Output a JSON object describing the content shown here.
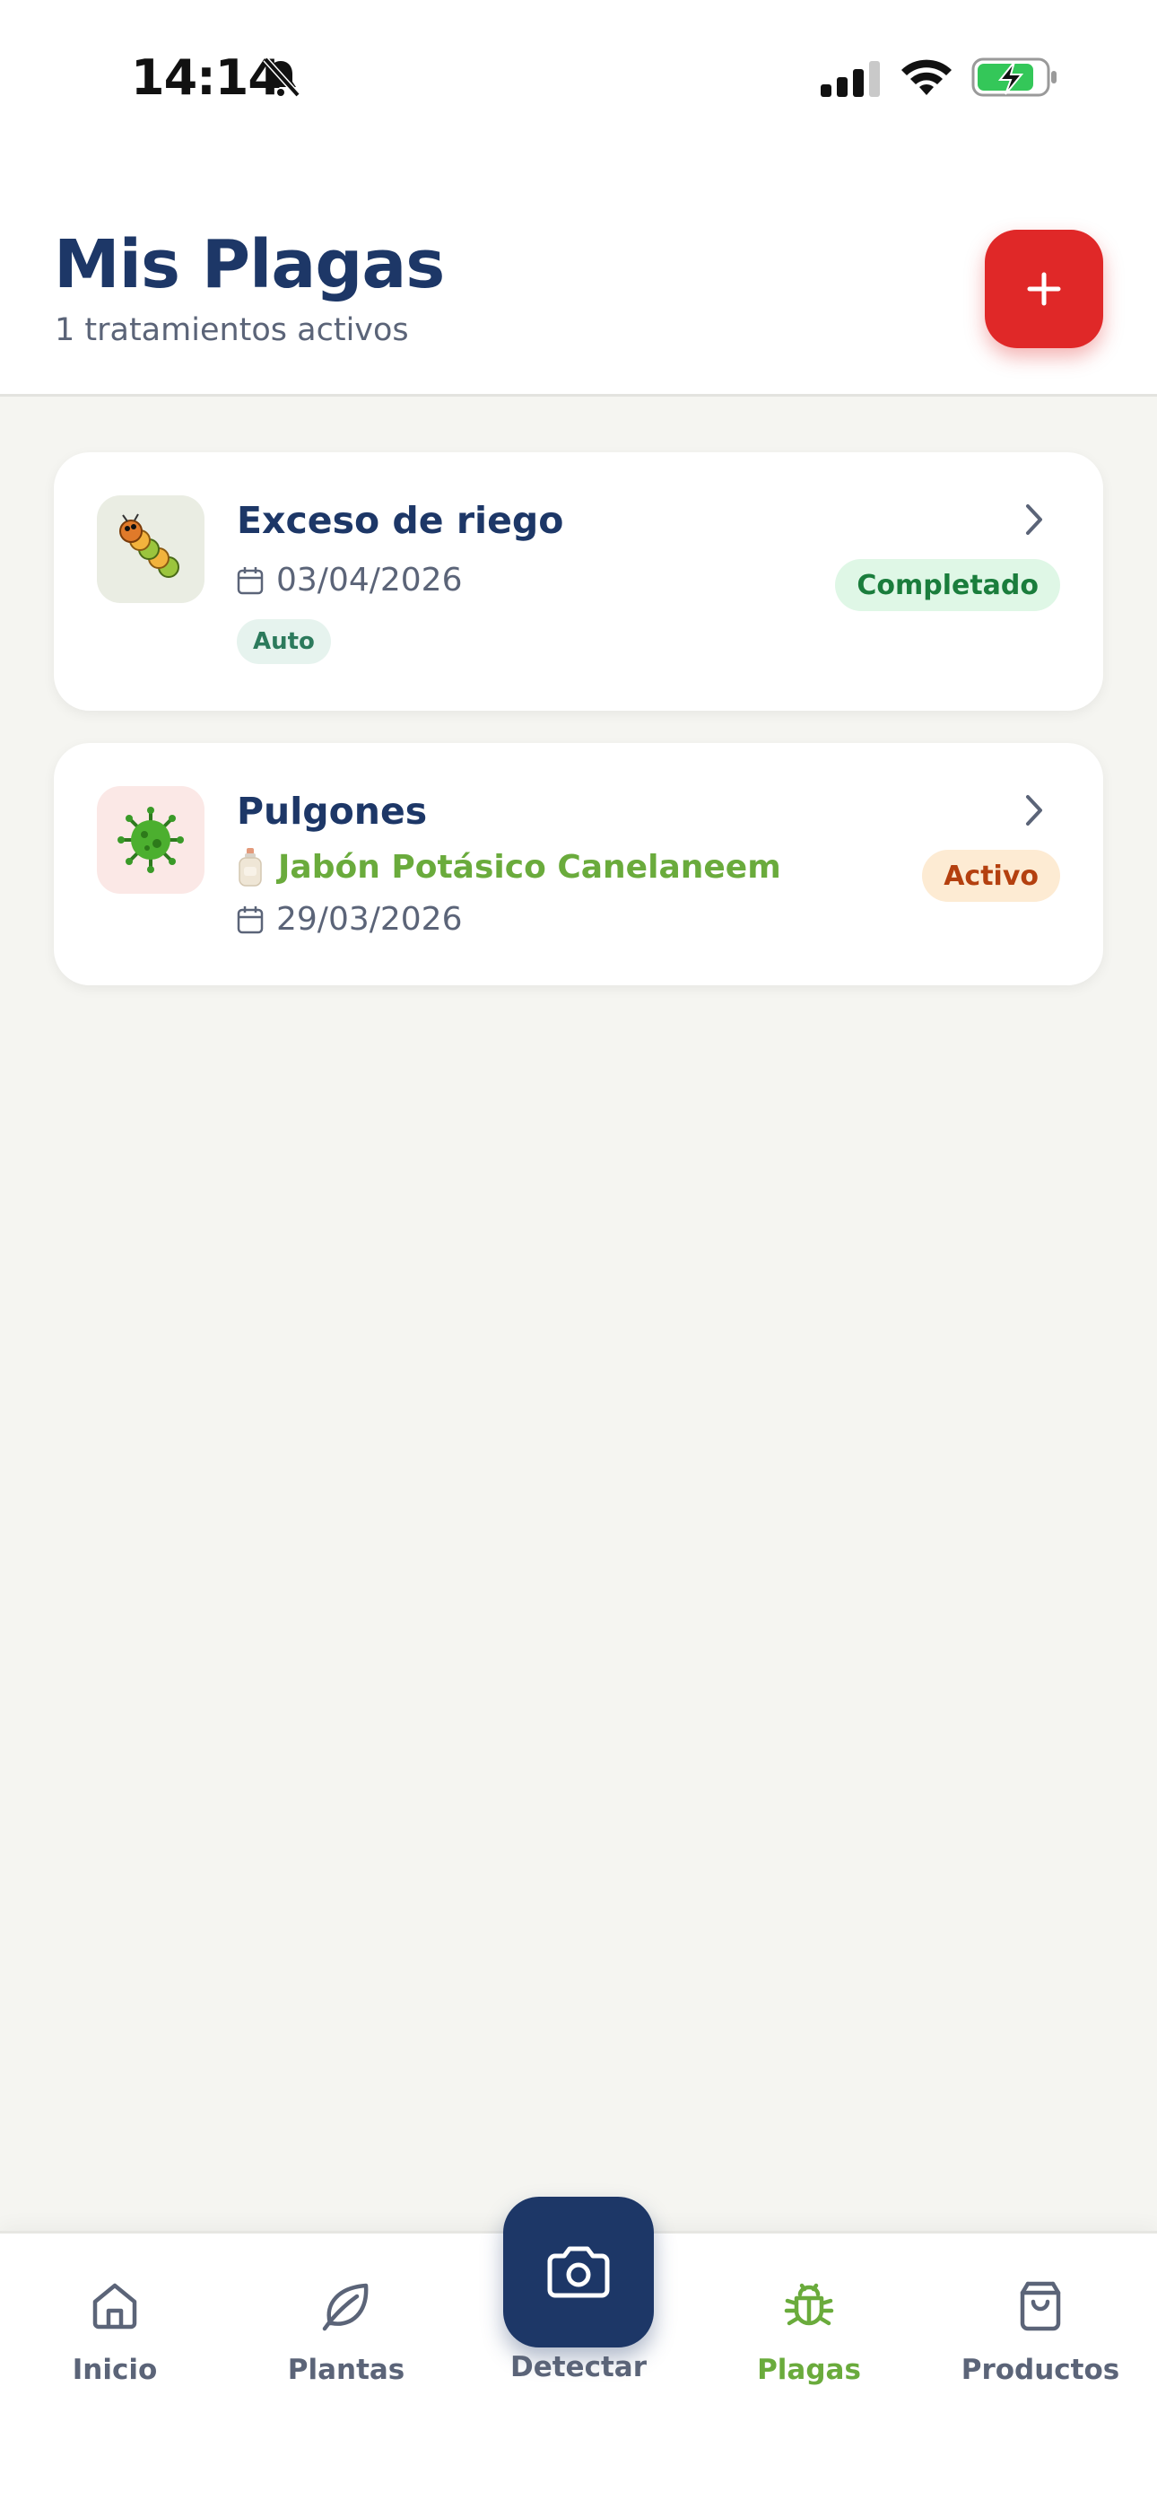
{
  "status_bar": {
    "time": "14:14"
  },
  "header": {
    "title": "Mis Plagas",
    "subtitle": "1 tratamientos activos",
    "add_button_icon": "plus-icon"
  },
  "treatments": [
    {
      "title": "Exceso de riego",
      "icon": "caterpillar-icon",
      "date": "03/04/2026",
      "tag": "Auto",
      "status": "Completado"
    },
    {
      "title": "Pulgones",
      "icon": "virus-icon",
      "product": "Jabón Potásico Canelaneem",
      "date": "29/03/2026",
      "status": "Activo"
    }
  ],
  "nav": {
    "items": [
      {
        "label": "Inicio",
        "icon": "home-icon"
      },
      {
        "label": "Plantas",
        "icon": "leaf-icon"
      },
      {
        "label": "Detectar",
        "icon": "camera-icon"
      },
      {
        "label": "Plagas",
        "icon": "bug-icon",
        "active": true
      },
      {
        "label": "Productos",
        "icon": "shopping-bag-icon"
      }
    ]
  },
  "colors": {
    "primary": "#1d3767",
    "accent_red": "#e02828",
    "accent_green": "#6aab3c",
    "background": "#f5f5f1"
  }
}
